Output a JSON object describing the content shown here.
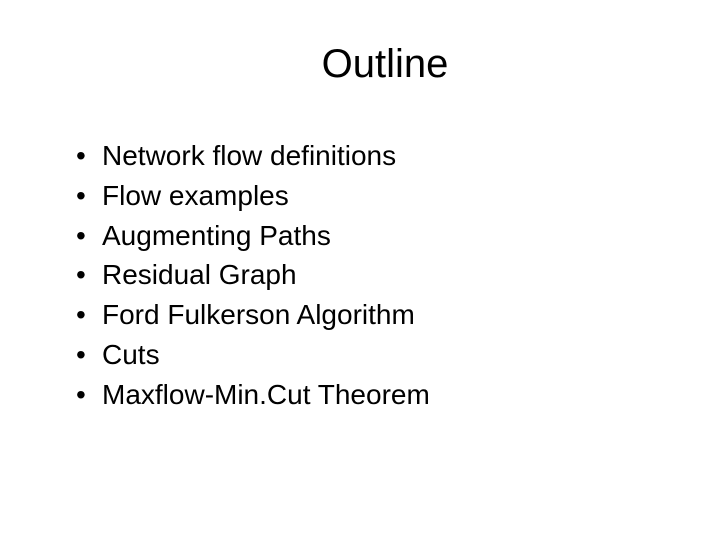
{
  "slide": {
    "title": "Outline",
    "bullets": [
      "Network flow definitions",
      "Flow examples",
      "Augmenting Paths",
      "Residual Graph",
      "Ford Fulkerson Algorithm",
      "Cuts",
      "Maxflow-Min.Cut Theorem"
    ]
  }
}
